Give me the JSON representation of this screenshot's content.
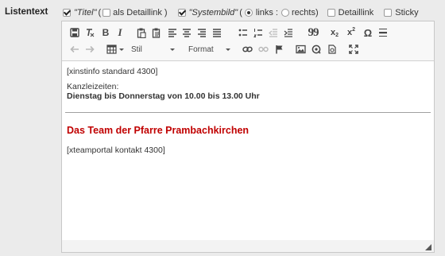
{
  "field": {
    "label": "Listentext"
  },
  "options": {
    "titel_label": "\"Titel\"",
    "open_paren_1": "(",
    "als_detaillink": "als Detaillink",
    "close_paren_1": ")",
    "systembild_label": "\"Systembild\"",
    "open_paren_2": "(",
    "links_label": "links :",
    "rechts_label": "rechts)",
    "detaillink_label": "Detaillink",
    "sticky_label": "Sticky",
    "titel_checked": true,
    "als_detaillink_checked": false,
    "systembild_checked": true,
    "links_selected": true,
    "rechts_selected": false,
    "detaillink_checked": false,
    "sticky_checked": false
  },
  "toolbar": {
    "format_bold": "B",
    "format_italic": "I",
    "style_dropdown": "Stil",
    "format_dropdown": "Format",
    "subscript": "x",
    "subscript_mark": "2",
    "superscript": "x",
    "superscript_mark": "2",
    "special_char": "Ω",
    "blockquote": "99"
  },
  "content": {
    "line1": "[xinstinfo standard 4300]",
    "line2": "Kanzleizeiten:",
    "line3": "Dienstag bis Donnerstag von 10.00 bis 13.00 Uhr",
    "heading": "Das Team der Pfarre Prambachkirchen",
    "line4": "[xteamportal kontakt 4300]"
  },
  "colors": {
    "heading": "#c00000",
    "background": "#ebebeb",
    "toolbar": "#f8f8f8"
  }
}
